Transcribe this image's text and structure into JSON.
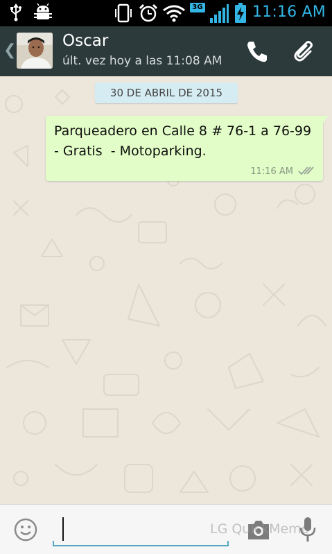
{
  "status_bar": {
    "time": "11:16 AM",
    "network_type": "3G",
    "icons": [
      "usb-icon",
      "android-debug-icon",
      "vibrate-icon",
      "alarm-icon",
      "wifi-icon",
      "signal-icon",
      "battery-charging-icon"
    ]
  },
  "header": {
    "contact_name": "Oscar",
    "last_seen": "últ. vez hoy a las 11:08 AM",
    "icons": [
      "back-chevron-icon",
      "call-icon",
      "attach-icon"
    ]
  },
  "chat": {
    "date_separator": "30 DE ABRIL DE 2015",
    "messages": [
      {
        "text": "Parqueadero en Calle 8 # 76-1 a 76-99 - Gratis  - Motoparking.",
        "time": "11:16 AM",
        "status": "delivered-double-tick",
        "direction": "outgoing"
      }
    ]
  },
  "input_bar": {
    "text_value": "",
    "icons": [
      "emoji-icon",
      "camera-icon",
      "mic-icon"
    ],
    "watermark": "LG QuickMemo"
  },
  "colors": {
    "status_bar_bg": "#000000",
    "status_accent": "#33b5e5",
    "header_bg": "#2c3a3b",
    "chat_bg": "#ece6db",
    "outgoing_bubble": "#e2fdc7",
    "date_pill": "#d6ecf3",
    "input_underline": "#54a6c4"
  }
}
